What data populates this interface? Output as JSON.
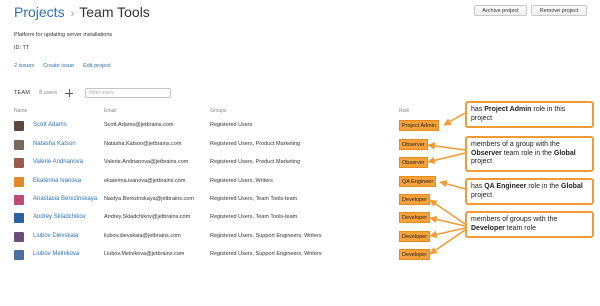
{
  "breadcrumb": {
    "parent": "Projects",
    "separator": "›",
    "current": "Team Tools"
  },
  "header_buttons": {
    "archive": "Archive project",
    "remove": "Remove project"
  },
  "project": {
    "description": "Platform for updating server installations",
    "id_line": "ID: TT"
  },
  "links": {
    "issues": "2 issues",
    "create_issue": "Create issue",
    "edit_project": "Edit project"
  },
  "team": {
    "label": "TEAM",
    "count": "8 users",
    "filter_placeholder": "Filter users"
  },
  "columns": {
    "name": "Name",
    "email": "Email",
    "groups": "Groups",
    "role": "Role"
  },
  "rows": [
    {
      "name": "Scott Adams",
      "email": "Scott.Adams@jetbrains.com",
      "groups": "Registered Users",
      "role": "Project Admin",
      "avatar_color": "#5b4a3f"
    },
    {
      "name": "Natasha Katson",
      "email": "Natasha.Katson@jetbrains.com",
      "groups": "Registered Users, Product Marketing",
      "role": "Observer",
      "avatar_color": "#7a6a5e"
    },
    {
      "name": "Valerie Andrianova",
      "email": "Valerie.Andrianova@jetbrains.com",
      "groups": "Registered Users, Product Marketing",
      "role": "Observer",
      "avatar_color": "#9a5c4c"
    },
    {
      "name": "Ekaterina Ivanova",
      "email": "ekaterina.ivanova@jetbrains.com",
      "groups": "Registered Users, Writers",
      "role": "QA Engineer",
      "avatar_color": "#e08a2c"
    },
    {
      "name": "Anastasia Berezinskaya",
      "email": "Nastya.Berezinskaya@jetbrains.com",
      "groups": "Registered Users, Team Tools-team",
      "role": "Developer",
      "avatar_color": "#c0497a"
    },
    {
      "name": "Andrey Skladchikov",
      "email": "Andrey.Skladchikov@jetbrains.com",
      "groups": "Registered Users, Team Tools-team",
      "role": "Developer",
      "avatar_color": "#2e5f9e"
    },
    {
      "name": "Liubov Dievskaia",
      "email": "liubov.dievskaia@jetbrains.com",
      "groups": "Registered Users, Support Engineers, Writers",
      "role": "Developer",
      "avatar_color": "#6b4f7a"
    },
    {
      "name": "Liubov Melnikova",
      "email": "Liubov.Melnikova@jetbrains.com",
      "groups": "Registered Users, Support Engineers, Writers",
      "role": "Developer",
      "avatar_color": "#4a6fa0"
    }
  ],
  "callouts": [
    {
      "t1": "has ",
      "b1": "Project Admin",
      "t2": " role in this project"
    },
    {
      "t1": "members of a group with the ",
      "b1": "Observer",
      "t2": " team role in the ",
      "b2": "Global",
      "t3": " project"
    },
    {
      "t1": "has ",
      "b1": "QA Engineer",
      "t2": " role in the ",
      "b2": "Global",
      "t3": " project"
    },
    {
      "t1": "members of groups with the ",
      "b1": "Developer",
      "t2": " team role"
    }
  ],
  "accent_color": "#f29a35",
  "link_color": "#2d72b8"
}
